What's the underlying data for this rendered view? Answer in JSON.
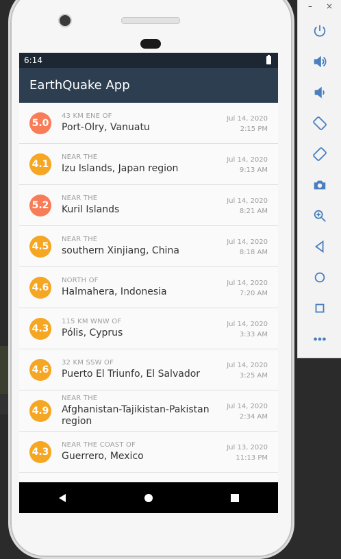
{
  "statusbar": {
    "time": "6:14"
  },
  "app": {
    "title": "EarthQuake App"
  },
  "colors": {
    "appbar": "#2c3e50",
    "statusbar": "#1c2733",
    "mag_orange": "#f5a623",
    "mag_red": "#f77d59"
  },
  "earthquakes": [
    {
      "mag": "5.0",
      "offset": "43 KM ENE OF",
      "place": "Port-Olry, Vanuatu",
      "date": "Jul 14, 2020",
      "time": "2:15 PM",
      "color": "#f77d59"
    },
    {
      "mag": "4.1",
      "offset": "NEAR THE",
      "place": "Izu Islands, Japan region",
      "date": "Jul 14, 2020",
      "time": "9:13 AM",
      "color": "#f5a623"
    },
    {
      "mag": "5.2",
      "offset": "NEAR THE",
      "place": "Kuril Islands",
      "date": "Jul 14, 2020",
      "time": "8:21 AM",
      "color": "#f77d59"
    },
    {
      "mag": "4.5",
      "offset": "NEAR THE",
      "place": "southern Xinjiang, China",
      "date": "Jul 14, 2020",
      "time": "8:18 AM",
      "color": "#f5a623"
    },
    {
      "mag": "4.6",
      "offset": "NORTH OF",
      "place": "Halmahera, Indonesia",
      "date": "Jul 14, 2020",
      "time": "7:20 AM",
      "color": "#f5a623"
    },
    {
      "mag": "4.3",
      "offset": "115 KM WNW OF",
      "place": "Pólis, Cyprus",
      "date": "Jul 14, 2020",
      "time": "3:33 AM",
      "color": "#f5a623"
    },
    {
      "mag": "4.6",
      "offset": "32 KM SSW OF",
      "place": "Puerto El Triunfo, El Salvador",
      "date": "Jul 14, 2020",
      "time": "3:25 AM",
      "color": "#f5a623"
    },
    {
      "mag": "4.9",
      "offset": "NEAR THE",
      "place": "Afghanistan-Tajikistan-Pakistan region",
      "date": "Jul 14, 2020",
      "time": "2:34 AM",
      "color": "#f5a623"
    },
    {
      "mag": "4.3",
      "offset": "NEAR THE COAST OF",
      "place": "Guerrero, Mexico",
      "date": "Jul 13, 2020",
      "time": "11:13 PM",
      "color": "#f5a623"
    }
  ],
  "emulator_toolbar": {
    "window_buttons": [
      "–",
      "×"
    ],
    "tools": [
      "power-icon",
      "volume-up-icon",
      "volume-down-icon",
      "rotate-left-icon",
      "rotate-right-icon",
      "camera-icon",
      "zoom-icon",
      "back-icon",
      "home-icon",
      "overview-icon",
      "more-icon"
    ]
  }
}
